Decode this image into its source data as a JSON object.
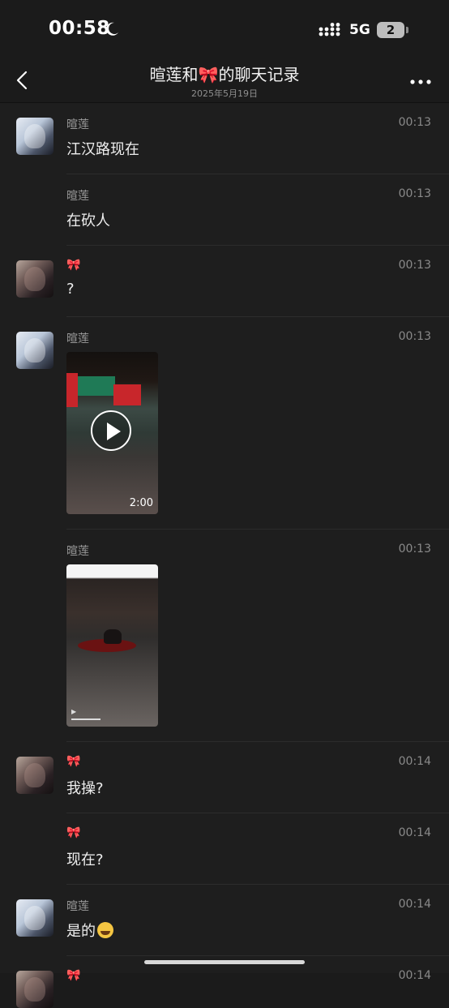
{
  "status_bar": {
    "time": "00:58",
    "network": "5G",
    "battery": "2"
  },
  "header": {
    "title": "暄莲和🎀的聊天记录",
    "subtitle": "2025年5月19日"
  },
  "messages": [
    {
      "sender": "暄莲",
      "time": "00:13",
      "text": "江汉路现在",
      "avatar": "a"
    },
    {
      "sender": "暄莲",
      "time": "00:13",
      "text": "在砍人"
    },
    {
      "sender": "🎀",
      "time": "00:13",
      "text": "?",
      "avatar": "b"
    },
    {
      "sender": "暄莲",
      "time": "00:13",
      "video_duration": "2:00",
      "avatar": "a"
    },
    {
      "sender": "暄莲",
      "time": "00:13"
    },
    {
      "sender": "🎀",
      "time": "00:14",
      "text": "我操?",
      "avatar": "b"
    },
    {
      "sender": "🎀",
      "time": "00:14",
      "text": "现在?"
    },
    {
      "sender": "暄莲",
      "time": "00:14",
      "text": "是的",
      "avatar": "a"
    },
    {
      "sender": "🎀",
      "time": "00:14"
    }
  ],
  "colors": {
    "background": "#1e1e1e",
    "divider": "#2c2c2c",
    "muted_text": "#9a9a9a"
  }
}
